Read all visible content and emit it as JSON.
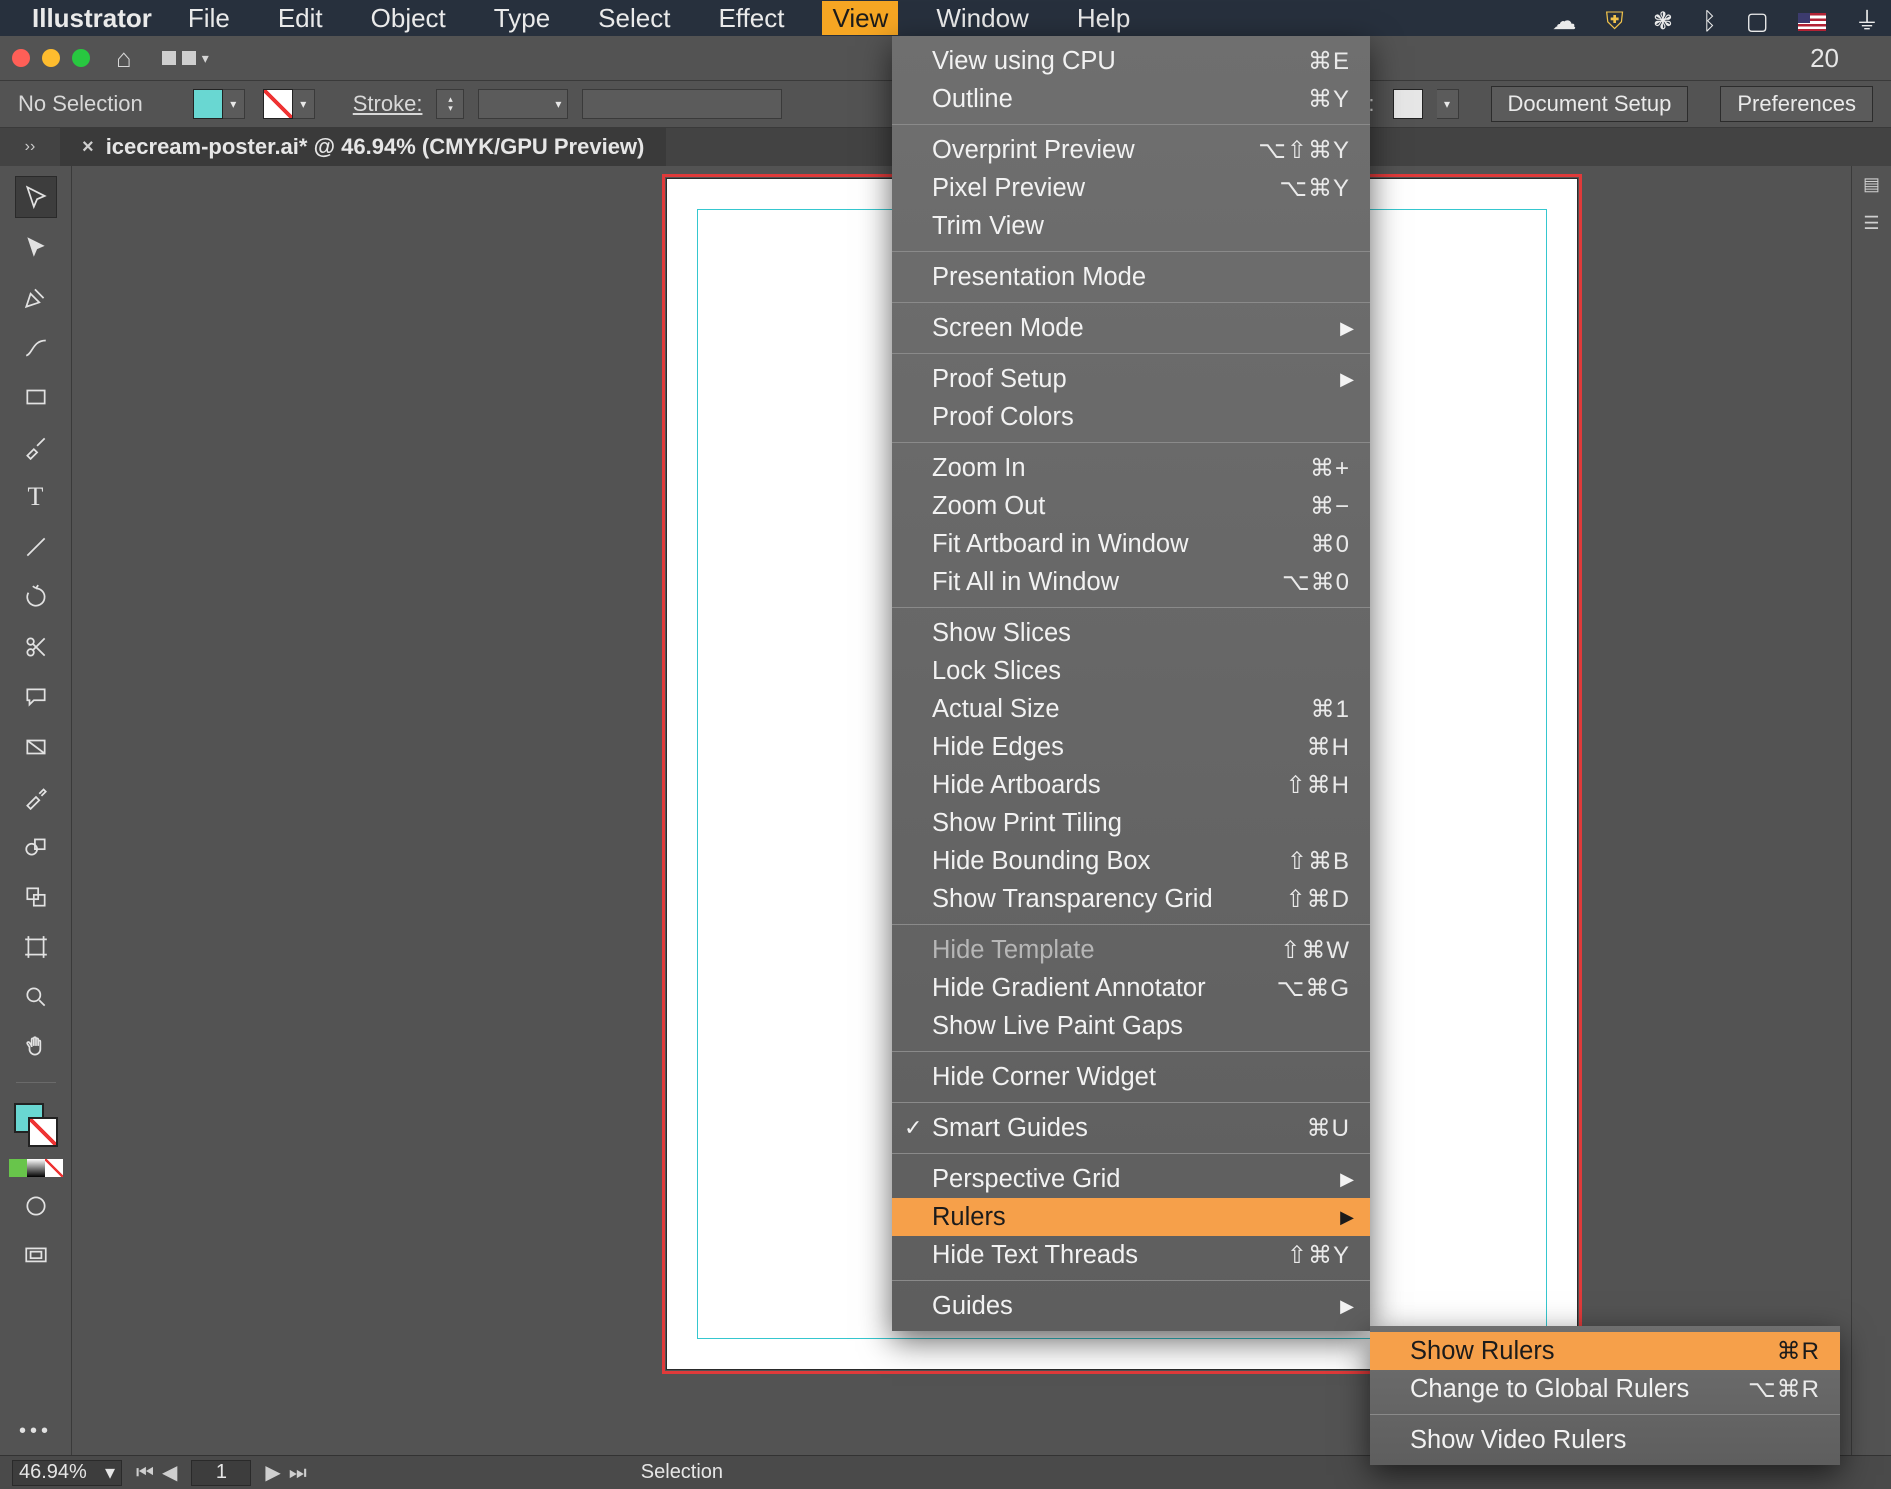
{
  "menubar": {
    "app": "Illustrator",
    "items": [
      "File",
      "Edit",
      "Object",
      "Type",
      "Select",
      "Effect",
      "View",
      "Window",
      "Help"
    ],
    "active_index": 6
  },
  "app_chrome": {
    "right_label": "20"
  },
  "control_bar": {
    "selection_label": "No Selection",
    "stroke_label": "Stroke:",
    "style_label": "Style:",
    "doc_setup": "Document Setup",
    "prefs": "Preferences"
  },
  "tab": {
    "title": "icecream-poster.ai* @ 46.94% (CMYK/GPU Preview)"
  },
  "tools": [
    "selection",
    "direct-selection",
    "pen",
    "curvature",
    "rectangle",
    "brush",
    "type",
    "segment",
    "rotate",
    "scissors",
    "speech",
    "gradient",
    "eyedropper",
    "blend",
    "symbol",
    "artboard",
    "zoom",
    "hand"
  ],
  "statusbar": {
    "zoom": "46.94%",
    "page": "1",
    "tool": "Selection"
  },
  "view_menu": [
    {
      "label": "View using CPU",
      "shortcut": "⌘E"
    },
    {
      "label": "Outline",
      "shortcut": "⌘Y"
    },
    {
      "sep": true
    },
    {
      "label": "Overprint Preview",
      "shortcut": "⌥⇧⌘Y"
    },
    {
      "label": "Pixel Preview",
      "shortcut": "⌥⌘Y"
    },
    {
      "label": "Trim View"
    },
    {
      "sep": true
    },
    {
      "label": "Presentation Mode"
    },
    {
      "sep": true
    },
    {
      "label": "Screen Mode",
      "submenu": true
    },
    {
      "sep": true
    },
    {
      "label": "Proof Setup",
      "submenu": true
    },
    {
      "label": "Proof Colors"
    },
    {
      "sep": true
    },
    {
      "label": "Zoom In",
      "shortcut": "⌘+"
    },
    {
      "label": "Zoom Out",
      "shortcut": "⌘−"
    },
    {
      "label": "Fit Artboard in Window",
      "shortcut": "⌘0"
    },
    {
      "label": "Fit All in Window",
      "shortcut": "⌥⌘0"
    },
    {
      "sep": true
    },
    {
      "label": "Show Slices"
    },
    {
      "label": "Lock Slices"
    },
    {
      "label": "Actual Size",
      "shortcut": "⌘1"
    },
    {
      "label": "Hide Edges",
      "shortcut": "⌘H"
    },
    {
      "label": "Hide Artboards",
      "shortcut": "⇧⌘H"
    },
    {
      "label": "Show Print Tiling"
    },
    {
      "label": "Hide Bounding Box",
      "shortcut": "⇧⌘B"
    },
    {
      "label": "Show Transparency Grid",
      "shortcut": "⇧⌘D"
    },
    {
      "sep": true
    },
    {
      "label": "Hide Template",
      "shortcut": "⇧⌘W",
      "disabled": true
    },
    {
      "label": "Hide Gradient Annotator",
      "shortcut": "⌥⌘G"
    },
    {
      "label": "Show Live Paint Gaps"
    },
    {
      "sep": true
    },
    {
      "label": "Hide Corner Widget"
    },
    {
      "sep": true
    },
    {
      "label": "Smart Guides",
      "shortcut": "⌘U",
      "checked": true
    },
    {
      "sep": true
    },
    {
      "label": "Perspective Grid",
      "submenu": true
    },
    {
      "label": "Rulers",
      "submenu": true,
      "highlight": true
    },
    {
      "label": "Hide Text Threads",
      "shortcut": "⇧⌘Y"
    },
    {
      "sep": true
    },
    {
      "label": "Guides",
      "submenu": true
    }
  ],
  "rulers_submenu": [
    {
      "label": "Show Rulers",
      "shortcut": "⌘R",
      "highlight": true
    },
    {
      "label": "Change to Global Rulers",
      "shortcut": "⌥⌘R"
    },
    {
      "sep": true
    },
    {
      "label": "Show Video Rulers"
    }
  ]
}
